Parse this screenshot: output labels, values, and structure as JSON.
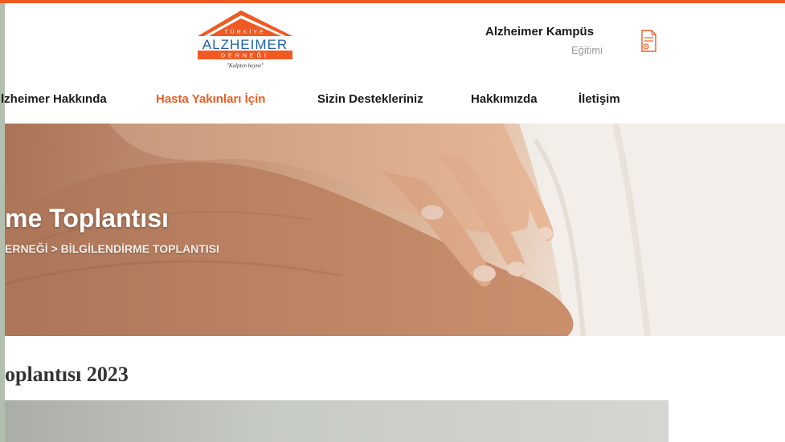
{
  "header": {
    "logo": {
      "line1": "TÜRKİYE",
      "line2": "ALZHEIMER",
      "line3": "DERNEĞİ",
      "tagline": "\"Kalpten beyne\"",
      "brand_color": "#f05a22"
    },
    "campus": {
      "title": "Alzheimer Kampüs",
      "subtitle": "Eğitimi",
      "icon": "certificate-icon"
    }
  },
  "nav": {
    "items": [
      {
        "label": "lzheimer Hakkında",
        "active": false
      },
      {
        "label": "Hasta Yakınları İçin",
        "active": true
      },
      {
        "label": "Sizin Destekleriniz",
        "active": false
      },
      {
        "label": "Hakkımızda",
        "active": false
      },
      {
        "label": "İletişim",
        "active": false
      }
    ],
    "active_color": "#f05a22"
  },
  "hero": {
    "title": "me Toplantısı",
    "breadcrumb": "ERNEĞİ > BİLGİLENDİRME TOPLANTISI"
  },
  "content": {
    "section_title": "oplantısı 2023"
  }
}
